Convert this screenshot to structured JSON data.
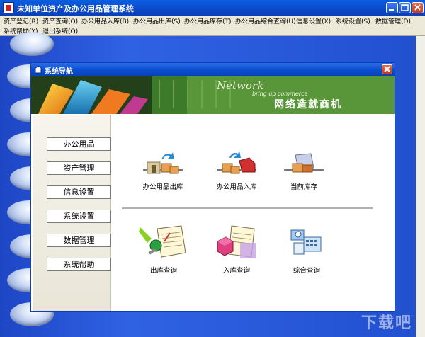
{
  "window": {
    "title": "未知单位资产及办公用品管理系统"
  },
  "menu": {
    "row1": [
      "资产登记(R)",
      "资产查询(Q)",
      "办公用品入库(B)",
      "办公用品出库(S)",
      "办公用品库存(T)",
      "办公用品综合查询(U)",
      "信息设置(X)",
      "系统设置(S)",
      "数据管理(D)"
    ],
    "row2": [
      "系统帮助(Y)",
      "退出系统(Q)"
    ]
  },
  "dialog": {
    "title": "系统导航",
    "banner": {
      "word": "Network",
      "sub": "bring up commerce",
      "cn": "网络造就商机"
    },
    "nav": [
      "办公用品",
      "资产管理",
      "信息设置",
      "系统设置",
      "数据管理",
      "系统帮助"
    ],
    "actions_top": [
      "办公用品出库",
      "办公用品入库",
      "当前库存"
    ],
    "actions_bottom": [
      "出库查询",
      "入库查询",
      "综合查询"
    ]
  },
  "watermark": "下载吧"
}
